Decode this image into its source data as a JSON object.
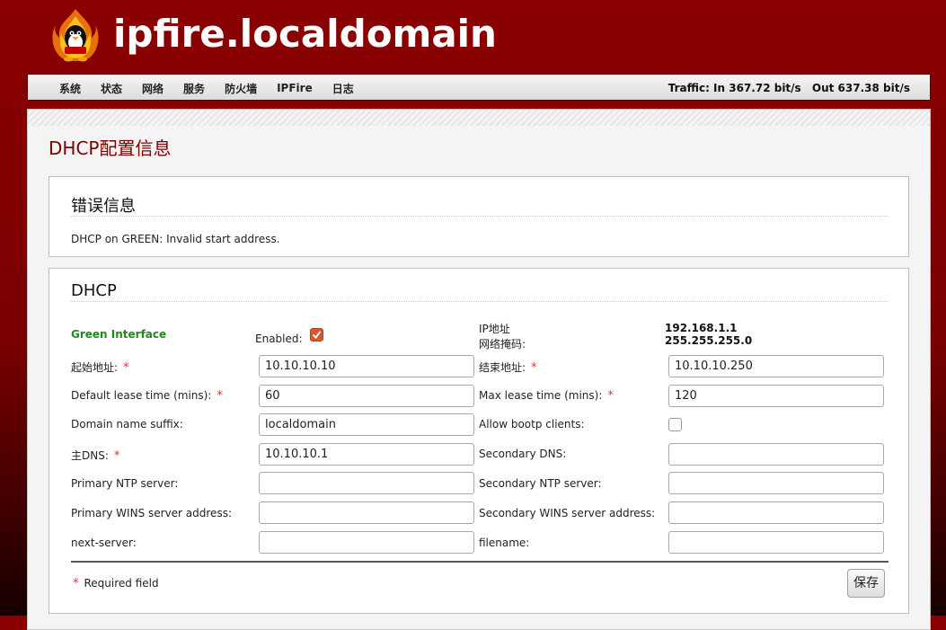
{
  "header": {
    "site_title": "ipfire.localdomain"
  },
  "nav": {
    "items": [
      "系统",
      "状态",
      "网络",
      "服务",
      "防火墙",
      "IPFire",
      "日志"
    ],
    "traffic_in": "Traffic: In 367.72 bit/s",
    "traffic_out": "Out 637.38 bit/s"
  },
  "page": {
    "title": "DHCP配置信息"
  },
  "error_box": {
    "title": "错误信息",
    "message": "DHCP on GREEN: Invalid start address."
  },
  "dhcp": {
    "title": "DHCP",
    "interface_label": "Green Interface",
    "enabled_label": "Enabled:",
    "enabled": true,
    "ip_label": "IP地址",
    "netmask_label": "网络掩码:",
    "ip_value": "192.168.1.1",
    "netmask_value": "255.255.255.0",
    "fields": {
      "start": {
        "label": "起始地址:",
        "value": "10.10.10.10"
      },
      "end": {
        "label": "结束地址:",
        "value": "10.10.10.250"
      },
      "default_lease": {
        "label": "Default lease time (mins):",
        "value": "60"
      },
      "max_lease": {
        "label": "Max lease time (mins):",
        "value": "120"
      },
      "domain_suffix": {
        "label": "Domain name suffix:",
        "value": "localdomain"
      },
      "bootp": {
        "label": "Allow bootp clients:",
        "checked": false
      },
      "primary_dns": {
        "label": "主DNS:",
        "value": "10.10.10.1"
      },
      "secondary_dns": {
        "label": "Secondary DNS:",
        "value": ""
      },
      "primary_ntp": {
        "label": "Primary NTP server:",
        "value": ""
      },
      "secondary_ntp": {
        "label": "Secondary NTP server:",
        "value": ""
      },
      "primary_wins": {
        "label": "Primary WINS server address:",
        "value": ""
      },
      "secondary_wins": {
        "label": "Secondary WINS server address:",
        "value": ""
      },
      "next_server": {
        "label": "next-server:",
        "value": ""
      },
      "filename": {
        "label": "filename:",
        "value": ""
      }
    },
    "required_marker": "*",
    "required_note": "Required field",
    "save_label": "保存"
  },
  "colors": {
    "header_red": "#8a0000",
    "interface_green": "#1f8a1f",
    "required_red": "#d43a3a",
    "title_red": "#7a0000"
  }
}
